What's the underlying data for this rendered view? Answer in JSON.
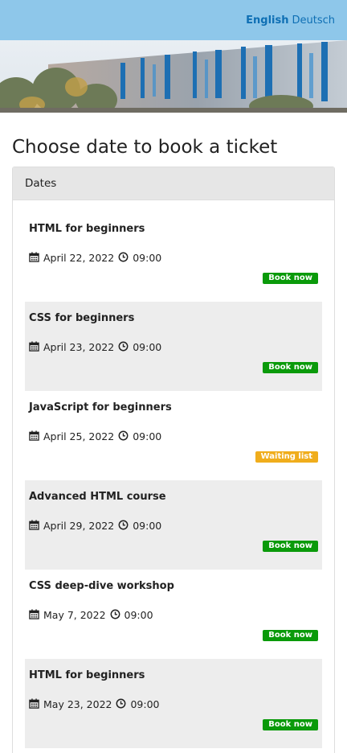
{
  "header": {
    "languages": [
      {
        "label": "English",
        "active": true
      },
      {
        "label": "Deutsch",
        "active": false
      }
    ]
  },
  "page_title": "Choose date to book a ticket",
  "panel": {
    "heading": "Dates",
    "events": [
      {
        "title": "HTML for beginners",
        "date": "April 22, 2022",
        "time": "09:00",
        "action": "Book now",
        "status": "book"
      },
      {
        "title": "CSS for beginners",
        "date": "April 23, 2022",
        "time": "09:00",
        "action": "Book now",
        "status": "book"
      },
      {
        "title": "JavaScript for beginners",
        "date": "April 25, 2022",
        "time": "09:00",
        "action": "Waiting list",
        "status": "wait"
      },
      {
        "title": "Advanced HTML course",
        "date": "April 29, 2022",
        "time": "09:00",
        "action": "Book now",
        "status": "book"
      },
      {
        "title": "CSS deep-dive workshop",
        "date": "May 7, 2022",
        "time": "09:00",
        "action": "Book now",
        "status": "book"
      },
      {
        "title": "HTML for beginners",
        "date": "May 23, 2022",
        "time": "09:00",
        "action": "Book now",
        "status": "book"
      }
    ]
  },
  "colors": {
    "topbar": "#8ec7ea",
    "link": "#0e6fb4",
    "book_badge": "#0a9a0a",
    "wait_badge": "#f0ad1c",
    "alt_row": "#ededed"
  }
}
